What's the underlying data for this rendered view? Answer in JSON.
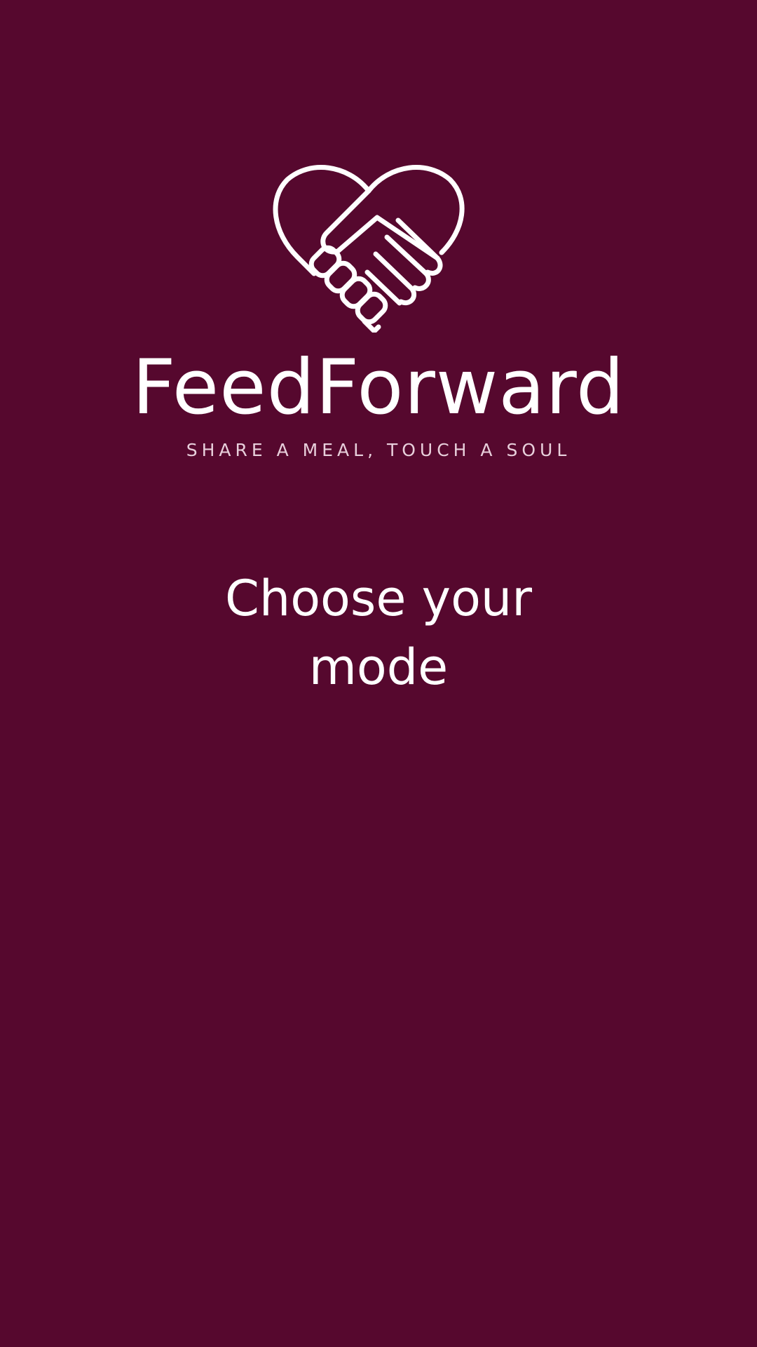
{
  "app": {
    "brand_name": "FeedForward",
    "tagline": "SHARE A MEAL, TOUCH A SOUL",
    "logo_icon": "heart-handshake-icon"
  },
  "main": {
    "title": "Choose your mode"
  },
  "colors": {
    "background": "#56082E",
    "text": "#FFFFFF"
  }
}
